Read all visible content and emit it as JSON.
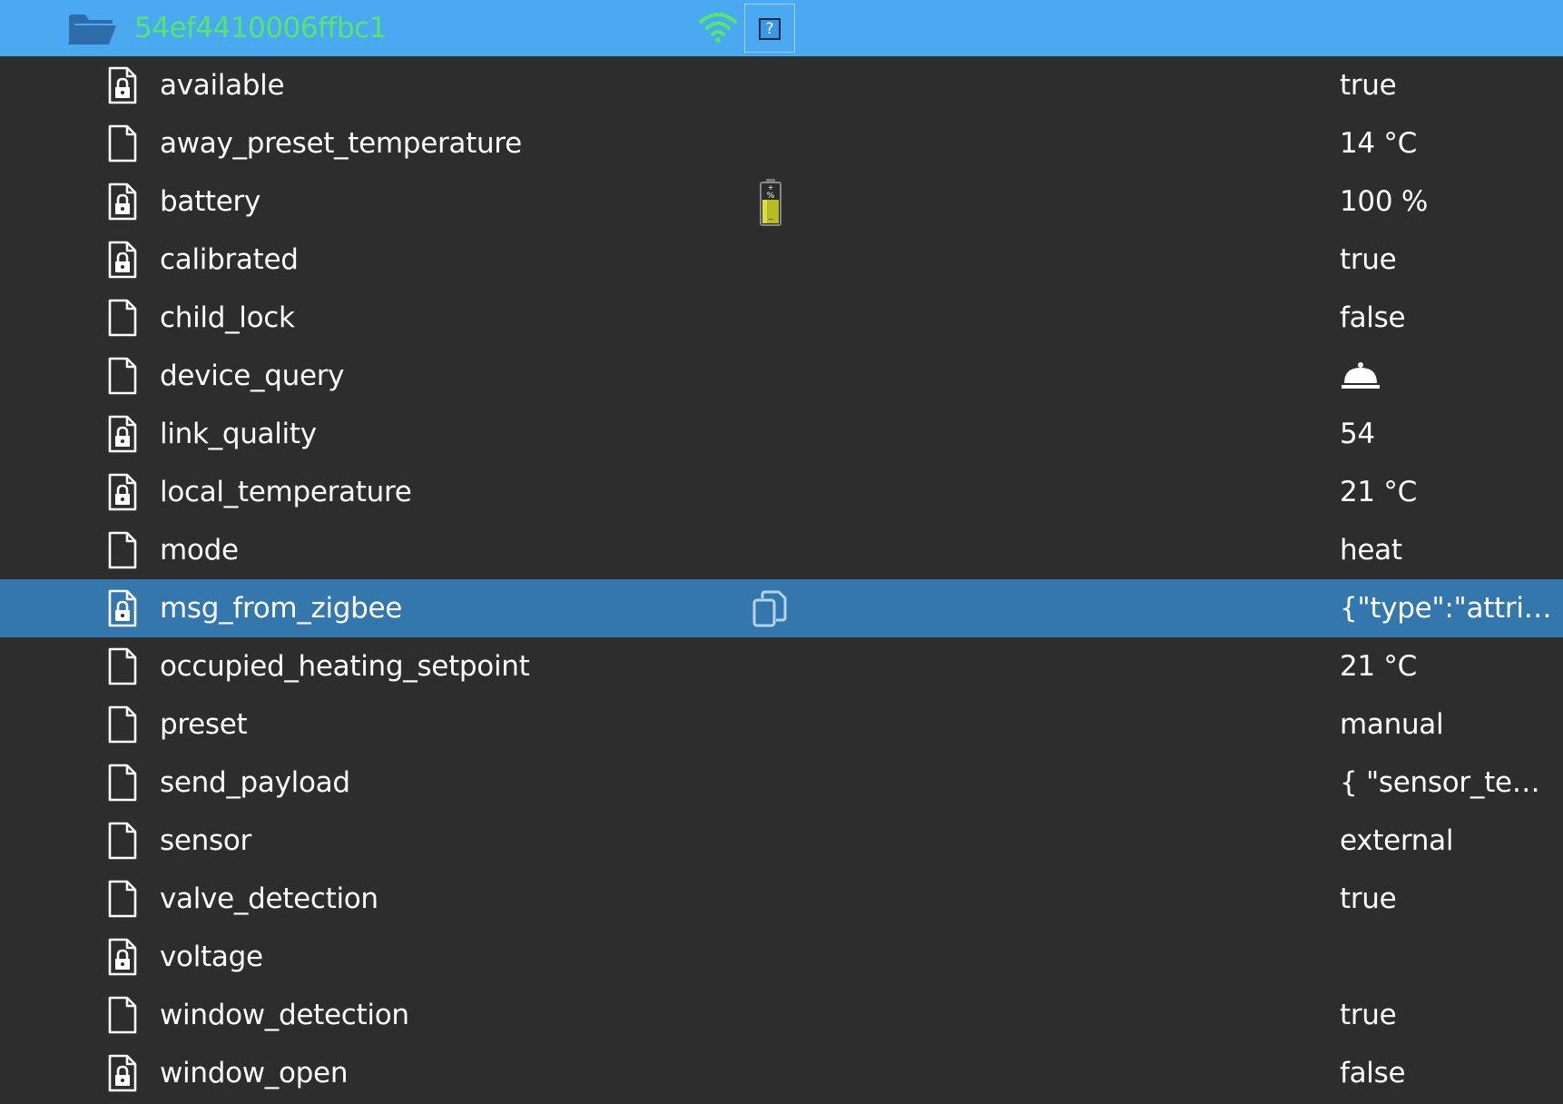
{
  "device": {
    "name": "54ef4410006ffbc1",
    "help_label": "?",
    "colors": {
      "header_bg": "#4aa9f1",
      "device_name": "#55e66c",
      "row_bg": "#2d2d2d",
      "selected_row_bg": "#3377ad"
    }
  },
  "states": [
    {
      "name": "available",
      "value": "true",
      "icon": "locked-file-icon",
      "read_only": true
    },
    {
      "name": "away_preset_temperature",
      "value": "14 °C",
      "icon": "file-icon",
      "read_only": false
    },
    {
      "name": "battery",
      "value": "100 %",
      "icon": "locked-file-icon",
      "read_only": true,
      "extra_icon": "battery-icon"
    },
    {
      "name": "calibrated",
      "value": "true",
      "icon": "locked-file-icon",
      "read_only": true
    },
    {
      "name": "child_lock",
      "value": "false",
      "icon": "file-icon",
      "read_only": false
    },
    {
      "name": "device_query",
      "value": "",
      "icon": "file-icon",
      "read_only": false,
      "value_icon": "service-bell-icon"
    },
    {
      "name": "link_quality",
      "value": "54",
      "icon": "locked-file-icon",
      "read_only": true
    },
    {
      "name": "local_temperature",
      "value": "21 °C",
      "icon": "locked-file-icon",
      "read_only": true
    },
    {
      "name": "mode",
      "value": "heat",
      "icon": "file-icon",
      "read_only": false
    },
    {
      "name": "msg_from_zigbee",
      "value": "{\"type\":\"attrib…",
      "icon": "locked-file-icon",
      "read_only": true,
      "selected": true,
      "extra_icon": "copy-icon"
    },
    {
      "name": "occupied_heating_setpoint",
      "value": "21 °C",
      "icon": "file-icon",
      "read_only": false
    },
    {
      "name": "preset",
      "value": "manual",
      "icon": "file-icon",
      "read_only": false
    },
    {
      "name": "send_payload",
      "value": "{ \"sensor_tem…",
      "icon": "file-icon",
      "read_only": false
    },
    {
      "name": "sensor",
      "value": "external",
      "icon": "file-icon",
      "read_only": false
    },
    {
      "name": "valve_detection",
      "value": "true",
      "icon": "file-icon",
      "read_only": false
    },
    {
      "name": "voltage",
      "value": "",
      "icon": "locked-file-icon",
      "read_only": true
    },
    {
      "name": "window_detection",
      "value": "true",
      "icon": "file-icon",
      "read_only": false
    },
    {
      "name": "window_open",
      "value": "false",
      "icon": "locked-file-icon",
      "read_only": true
    }
  ]
}
